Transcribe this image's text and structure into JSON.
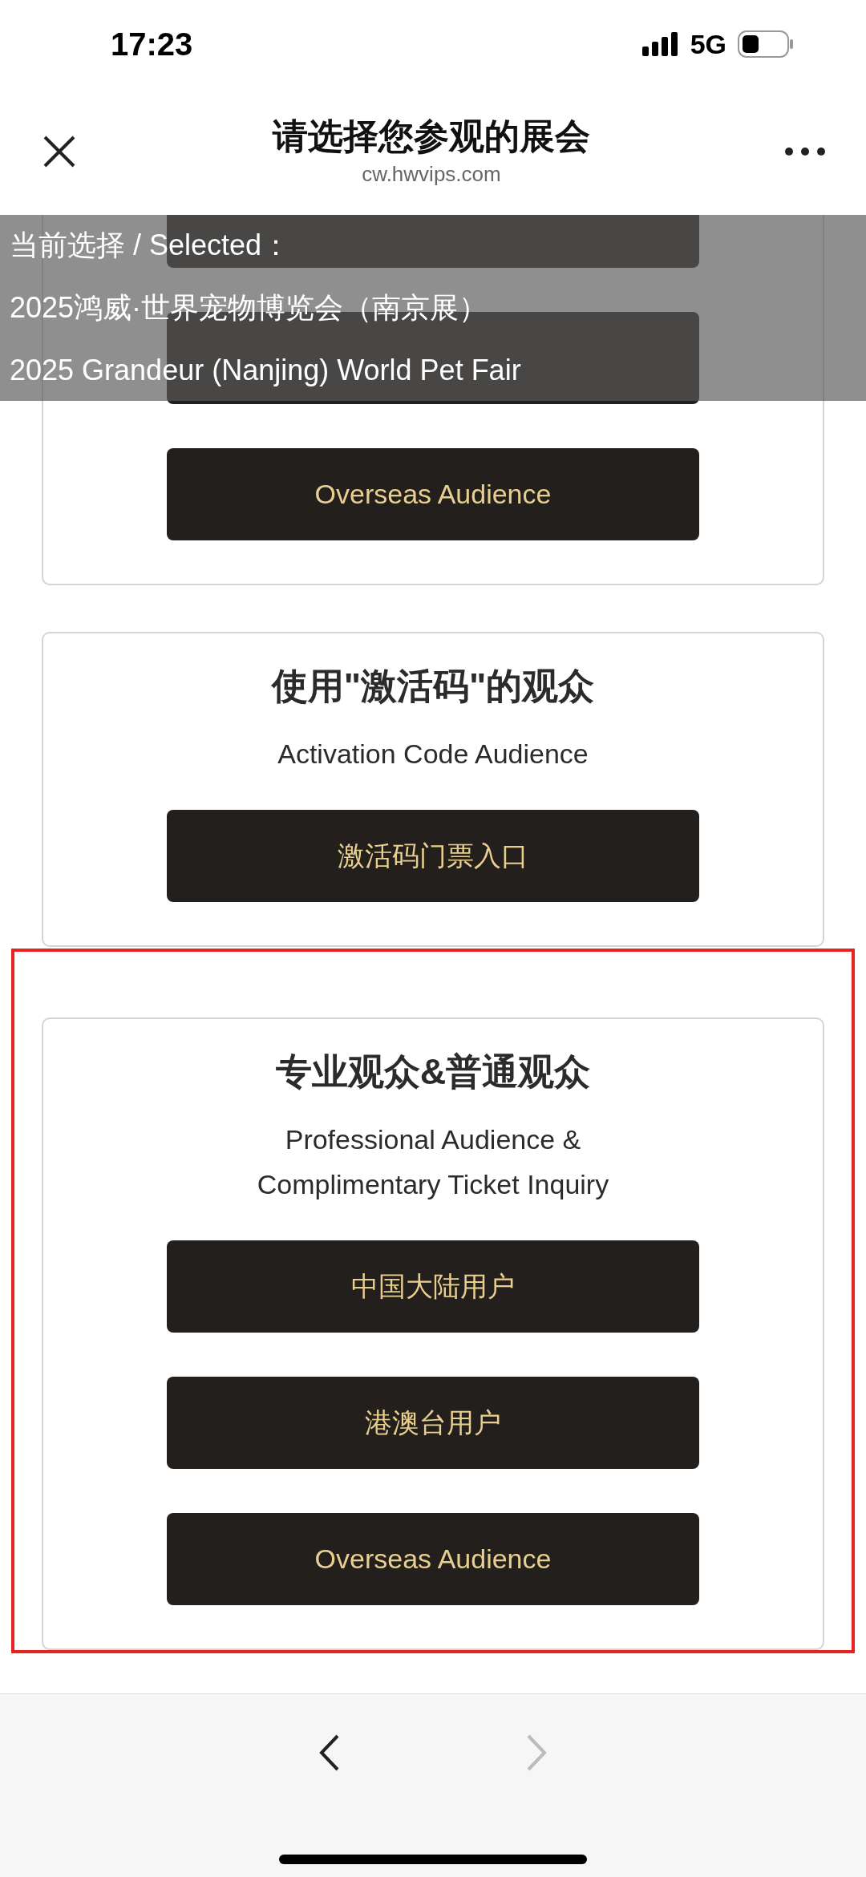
{
  "status_bar": {
    "time": "17:23",
    "network": "5G"
  },
  "header": {
    "title": "请选择您参观的展会",
    "url": "cw.hwvips.com"
  },
  "selection_banner": {
    "lines": [
      "当前选择 / Selected：",
      "2025鸿威·世界宠物博览会（南京展）",
      "2025 Grandeur (Nanjing) World Pet Fair"
    ]
  },
  "cards": [
    {
      "highlighted": false,
      "buttons": [
        {
          "kind": "covered"
        },
        {
          "kind": "covered"
        },
        {
          "kind": "label",
          "label": "Overseas Audience"
        }
      ]
    },
    {
      "highlighted": false,
      "title": "使用\"激活码\"的观众",
      "subtitle": [
        "Activation Code Audience"
      ],
      "buttons": [
        {
          "kind": "label",
          "label": "激活码门票入口"
        }
      ]
    },
    {
      "highlighted": true,
      "title": "专业观众&普通观众",
      "subtitle": [
        "Professional Audience &",
        "Complimentary Ticket Inquiry"
      ],
      "buttons": [
        {
          "kind": "label",
          "label": "中国大陆用户"
        },
        {
          "kind": "label",
          "label": "港澳台用户"
        },
        {
          "kind": "label",
          "label": "Overseas Audience"
        }
      ]
    }
  ],
  "nav": {
    "back_disabled": false,
    "forward_disabled": true
  }
}
